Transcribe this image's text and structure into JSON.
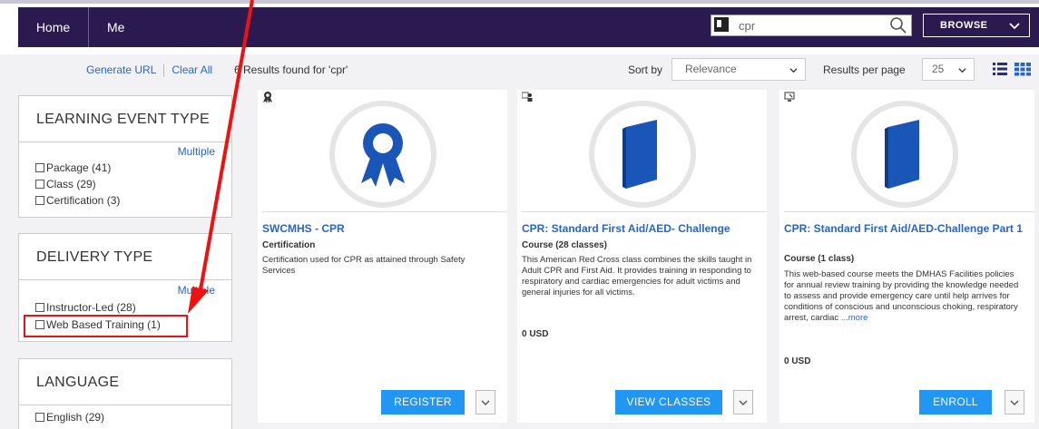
{
  "nav": {
    "home": "Home",
    "me": "Me",
    "search_value": "cpr",
    "browse": "BROWSE"
  },
  "sidebar": {
    "generate_url": "Generate URL",
    "clear_all": "Clear All",
    "facets": [
      {
        "title": "LEARNING EVENT TYPE",
        "multiple": "Multiple",
        "options": [
          "Package (41)",
          "Class (29)",
          "Certification (3)"
        ]
      },
      {
        "title": "DELIVERY TYPE",
        "multiple": "Multiple",
        "options": [
          "Instructor-Led (28)",
          "Web Based Training (1)"
        ]
      },
      {
        "title": "LANGUAGE",
        "options": [
          "English (29)"
        ]
      }
    ]
  },
  "results": {
    "count_text": "6 Results found for 'cpr'",
    "sort_label": "Sort by",
    "sort_value": "Relevance",
    "rpp_label": "Results per page",
    "rpp_value": "25"
  },
  "cards": [
    {
      "type_icon": "ribbon-icon",
      "title": "SWCMHS - CPR",
      "subtitle": "Certification",
      "description": "Certification used for CPR as attained through Safety Services",
      "price": "",
      "button": "REGISTER"
    },
    {
      "type_icon": "instructor-icon",
      "title": "CPR: Standard First Aid/AED- Challenge",
      "subtitle": "Course (28 classes)",
      "description": "This American Red Cross class combines the skills taught in Adult CPR and First Aid. It provides training in responding to respiratory and cardiac emergencies for adult victims and general injuries for all victims.",
      "price": "0 USD",
      "button": "VIEW CLASSES"
    },
    {
      "type_icon": "computer-icon",
      "title": "CPR: Standard First Aid/AED-Challenge Part 1",
      "subtitle": "Course (1 class)",
      "description": "This web-based course meets the DMHAS Facilities policies for annual review training by providing the knowledge needed to assess and provide emergency care until help arrives for conditions of conscious and unconscious choking, respiratory arrest, cardiac ",
      "more": "...more",
      "price": "0 USD",
      "button": "ENROLL"
    }
  ],
  "colors": {
    "nav_bg": "#2b1a4f",
    "link": "#2a64c5",
    "button": "#2196f3",
    "annotation": "#e11111"
  }
}
